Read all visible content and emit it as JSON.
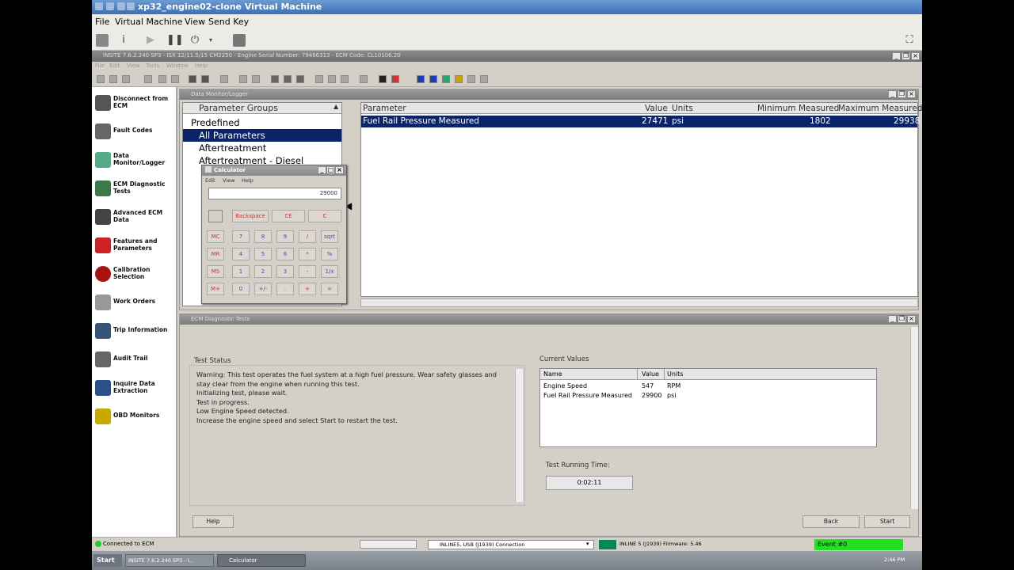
{
  "vm": {
    "title": "xp32_engine02-clone Virtual Machine",
    "menu": [
      "File",
      "Virtual Machine",
      "View",
      "Send Key"
    ]
  },
  "guest": {
    "title": "INSITE 7.6.2.240 SP3 - ISX 12/11.5/15 CM2250 - Engine Serial Number: 79466313 - ECM Code: CL10106.20",
    "menu": [
      "File",
      "Edit",
      "View",
      "Tools",
      "Window",
      "Help"
    ]
  },
  "nav": {
    "items": [
      {
        "label": "Disconnect from ECM",
        "icon": "disconnect-icon"
      },
      {
        "label": "Fault Codes",
        "icon": "fault-codes-icon"
      },
      {
        "label": "Data Monitor/Logger",
        "icon": "data-monitor-icon"
      },
      {
        "label": "ECM Diagnostic Tests",
        "icon": "diagnostic-icon"
      },
      {
        "label": "Advanced ECM Data",
        "icon": "advanced-data-icon"
      },
      {
        "label": "Features and Parameters",
        "icon": "features-icon"
      },
      {
        "label": "Calibration Selection",
        "icon": "calibration-icon"
      },
      {
        "label": "Work Orders",
        "icon": "work-orders-icon"
      },
      {
        "label": "Trip Information",
        "icon": "trip-icon"
      },
      {
        "label": "Audit Trail",
        "icon": "audit-icon"
      },
      {
        "label": "Inquire Data Extraction",
        "icon": "inquire-icon"
      },
      {
        "label": "OBD Monitors",
        "icon": "obd-icon"
      }
    ]
  },
  "data_monitor": {
    "title": "Data Monitor/Logger",
    "groups_header": "Parameter Groups",
    "groups": [
      "Predefined",
      "All Parameters",
      "Aftertreatment",
      "Aftertreatment - Diesel"
    ],
    "table_headers": {
      "parameter": "Parameter",
      "value": "Value",
      "units": "Units",
      "min": "Minimum Measured",
      "max": "Maximum Measured"
    },
    "row": {
      "parameter": "Fuel Rail Pressure Measured",
      "value": "27471",
      "units": "psi",
      "min": "1802",
      "max": "29938"
    }
  },
  "calculator": {
    "title": "Calculator",
    "menu": [
      "Edit",
      "View",
      "Help"
    ],
    "display": "29000",
    "top_keys": [
      "Backspace",
      "CE",
      "C"
    ],
    "rows": [
      [
        "MC",
        "7",
        "8",
        "9",
        "/",
        "sqrt"
      ],
      [
        "MR",
        "4",
        "5",
        "6",
        "*",
        "%"
      ],
      [
        "MS",
        "1",
        "2",
        "3",
        "-",
        "1/x"
      ],
      [
        "M+",
        "0",
        "+/-",
        ".",
        "+",
        "="
      ]
    ]
  },
  "diag": {
    "title": "ECM Diagnostic Tests",
    "test_status_label": "Test Status",
    "status_lines": [
      "Warning: This test operates the fuel system at a high fuel pressure. Wear safety glasses and",
      "stay clear from the engine when running this test.",
      "Initializing test, please wait.",
      "Test in progress.",
      "Low Engine Speed detected.",
      "Increase the engine speed and select Start to restart the test."
    ],
    "current_values_label": "Current Values",
    "cv_headers": {
      "name": "Name",
      "value": "Value",
      "units": "Units"
    },
    "cv_rows": [
      {
        "name": "Engine Speed",
        "value": "547",
        "units": "RPM"
      },
      {
        "name": "Fuel Rail Pressure Measured",
        "value": "29900",
        "units": "psi"
      }
    ],
    "running_time_label": "Test Running Time:",
    "running_time": "0:02:11",
    "help": "Help",
    "back": "Back",
    "start": "Start"
  },
  "statusbar": {
    "connected": "Connected to ECM",
    "adapter": "INLINE5, USB (J1939) Connection",
    "firmware": "INLINE 5 (J1939) Firmware: 5.46",
    "event": "Event #0"
  },
  "taskbar": {
    "start": "Start",
    "task1": "INSITE 7.6.2.240 SP3 - I...",
    "task2": "Calculator",
    "clock": "2:46 PM"
  },
  "colors": {
    "selection": "#0a246a",
    "event_green": "#22e022"
  }
}
